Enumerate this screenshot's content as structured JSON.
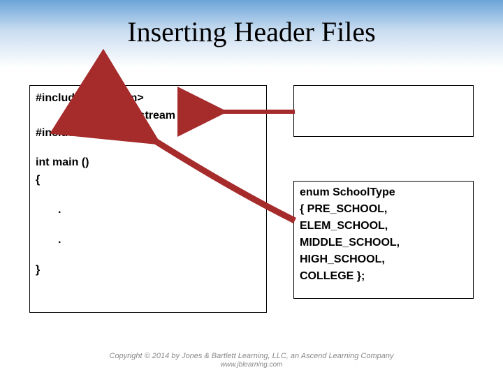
{
  "title": "Inserting Header Files",
  "left_box": {
    "l1": "#include  <iostream>",
    "l2": "// iostream",
    "l3": "#include  “school. h”",
    "l4": "int   main ()",
    "l5": "{",
    "d1": ".",
    "d2": ".",
    "l6": "}"
  },
  "right_box": {
    "l1": "enum  SchoolType",
    "l2": "{ PRE_SCHOOL,",
    "l3": " ELEM_SCHOOL,",
    "l4": "MIDDLE_SCHOOL,",
    "l5": " HIGH_SCHOOL,",
    "l6": "COLLEGE };"
  },
  "footer": {
    "line1": "Copyright © 2014 by Jones & Bartlett Learning, LLC, an Ascend Learning Company",
    "line2": "www.jblearning.com"
  }
}
